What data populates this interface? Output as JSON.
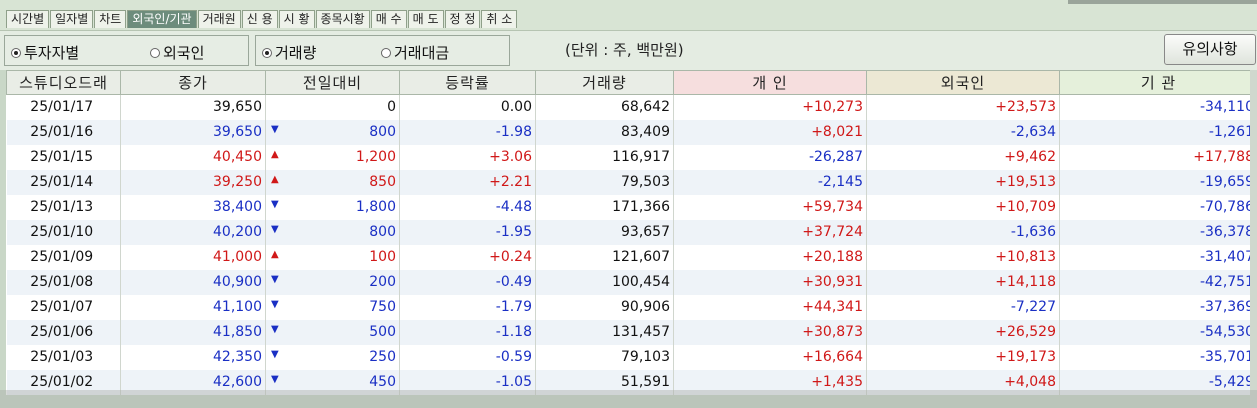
{
  "tabs": [
    "시간별",
    "일자별",
    "차트",
    "외국인/기관",
    "거래원",
    "신 용",
    "시 황",
    "종목시황",
    "매 수",
    "매 도",
    "정 정",
    "취 소"
  ],
  "active_tab": 3,
  "options": {
    "group1": {
      "selected": "투자자별",
      "other": "외국인"
    },
    "group2": {
      "selected": "거래량",
      "other": "거래대금"
    },
    "unit": "(단위 : 주, 백만원)",
    "notice_button": "유의사항"
  },
  "columns": [
    "스튜디오드래",
    "종가",
    "전일대비",
    "등락률",
    "거래량",
    "개 인",
    "외국인",
    "기 관"
  ],
  "colors": {
    "up": "#d01818",
    "down": "#1a2fc4",
    "neutral": "#111111"
  },
  "rows": [
    {
      "date": "25/01/17",
      "close": "39,650",
      "close_dir": "nt",
      "chg": "0",
      "chg_dir": "nt",
      "rate": "0.00",
      "rate_dir": "nt",
      "volume": "68,642",
      "ind": "+10,273",
      "ind_dir": "up",
      "for": "+23,573",
      "for_dir": "up",
      "inst": "-34,110",
      "inst_dir": "dn"
    },
    {
      "date": "25/01/16",
      "close": "39,650",
      "close_dir": "dn",
      "chg": "800",
      "chg_dir": "dn",
      "rate": "-1.98",
      "rate_dir": "dn",
      "volume": "83,409",
      "ind": "+8,021",
      "ind_dir": "up",
      "for": "-2,634",
      "for_dir": "dn",
      "inst": "-1,261",
      "inst_dir": "dn"
    },
    {
      "date": "25/01/15",
      "close": "40,450",
      "close_dir": "up",
      "chg": "1,200",
      "chg_dir": "up",
      "rate": "+3.06",
      "rate_dir": "up",
      "volume": "116,917",
      "ind": "-26,287",
      "ind_dir": "dn",
      "for": "+9,462",
      "for_dir": "up",
      "inst": "+17,788",
      "inst_dir": "up"
    },
    {
      "date": "25/01/14",
      "close": "39,250",
      "close_dir": "up",
      "chg": "850",
      "chg_dir": "up",
      "rate": "+2.21",
      "rate_dir": "up",
      "volume": "79,503",
      "ind": "-2,145",
      "ind_dir": "dn",
      "for": "+19,513",
      "for_dir": "up",
      "inst": "-19,659",
      "inst_dir": "dn"
    },
    {
      "date": "25/01/13",
      "close": "38,400",
      "close_dir": "dn",
      "chg": "1,800",
      "chg_dir": "dn",
      "rate": "-4.48",
      "rate_dir": "dn",
      "volume": "171,366",
      "ind": "+59,734",
      "ind_dir": "up",
      "for": "+10,709",
      "for_dir": "up",
      "inst": "-70,786",
      "inst_dir": "dn"
    },
    {
      "date": "25/01/10",
      "close": "40,200",
      "close_dir": "dn",
      "chg": "800",
      "chg_dir": "dn",
      "rate": "-1.95",
      "rate_dir": "dn",
      "volume": "93,657",
      "ind": "+37,724",
      "ind_dir": "up",
      "for": "-1,636",
      "for_dir": "dn",
      "inst": "-36,378",
      "inst_dir": "dn"
    },
    {
      "date": "25/01/09",
      "close": "41,000",
      "close_dir": "up",
      "chg": "100",
      "chg_dir": "up",
      "rate": "+0.24",
      "rate_dir": "up",
      "volume": "121,607",
      "ind": "+20,188",
      "ind_dir": "up",
      "for": "+10,813",
      "for_dir": "up",
      "inst": "-31,407",
      "inst_dir": "dn"
    },
    {
      "date": "25/01/08",
      "close": "40,900",
      "close_dir": "dn",
      "chg": "200",
      "chg_dir": "dn",
      "rate": "-0.49",
      "rate_dir": "dn",
      "volume": "100,454",
      "ind": "+30,931",
      "ind_dir": "up",
      "for": "+14,118",
      "for_dir": "up",
      "inst": "-42,751",
      "inst_dir": "dn"
    },
    {
      "date": "25/01/07",
      "close": "41,100",
      "close_dir": "dn",
      "chg": "750",
      "chg_dir": "dn",
      "rate": "-1.79",
      "rate_dir": "dn",
      "volume": "90,906",
      "ind": "+44,341",
      "ind_dir": "up",
      "for": "-7,227",
      "for_dir": "dn",
      "inst": "-37,369",
      "inst_dir": "dn"
    },
    {
      "date": "25/01/06",
      "close": "41,850",
      "close_dir": "dn",
      "chg": "500",
      "chg_dir": "dn",
      "rate": "-1.18",
      "rate_dir": "dn",
      "volume": "131,457",
      "ind": "+30,873",
      "ind_dir": "up",
      "for": "+26,529",
      "for_dir": "up",
      "inst": "-54,530",
      "inst_dir": "dn"
    },
    {
      "date": "25/01/03",
      "close": "42,350",
      "close_dir": "dn",
      "chg": "250",
      "chg_dir": "dn",
      "rate": "-0.59",
      "rate_dir": "dn",
      "volume": "79,103",
      "ind": "+16,664",
      "ind_dir": "up",
      "for": "+19,173",
      "for_dir": "up",
      "inst": "-35,701",
      "inst_dir": "dn"
    },
    {
      "date": "25/01/02",
      "close": "42,600",
      "close_dir": "dn",
      "chg": "450",
      "chg_dir": "dn",
      "rate": "-1.05",
      "rate_dir": "dn",
      "volume": "51,591",
      "ind": "+1,435",
      "ind_dir": "up",
      "for": "+4,048",
      "for_dir": "up",
      "inst": "-5,429",
      "inst_dir": "dn"
    }
  ]
}
